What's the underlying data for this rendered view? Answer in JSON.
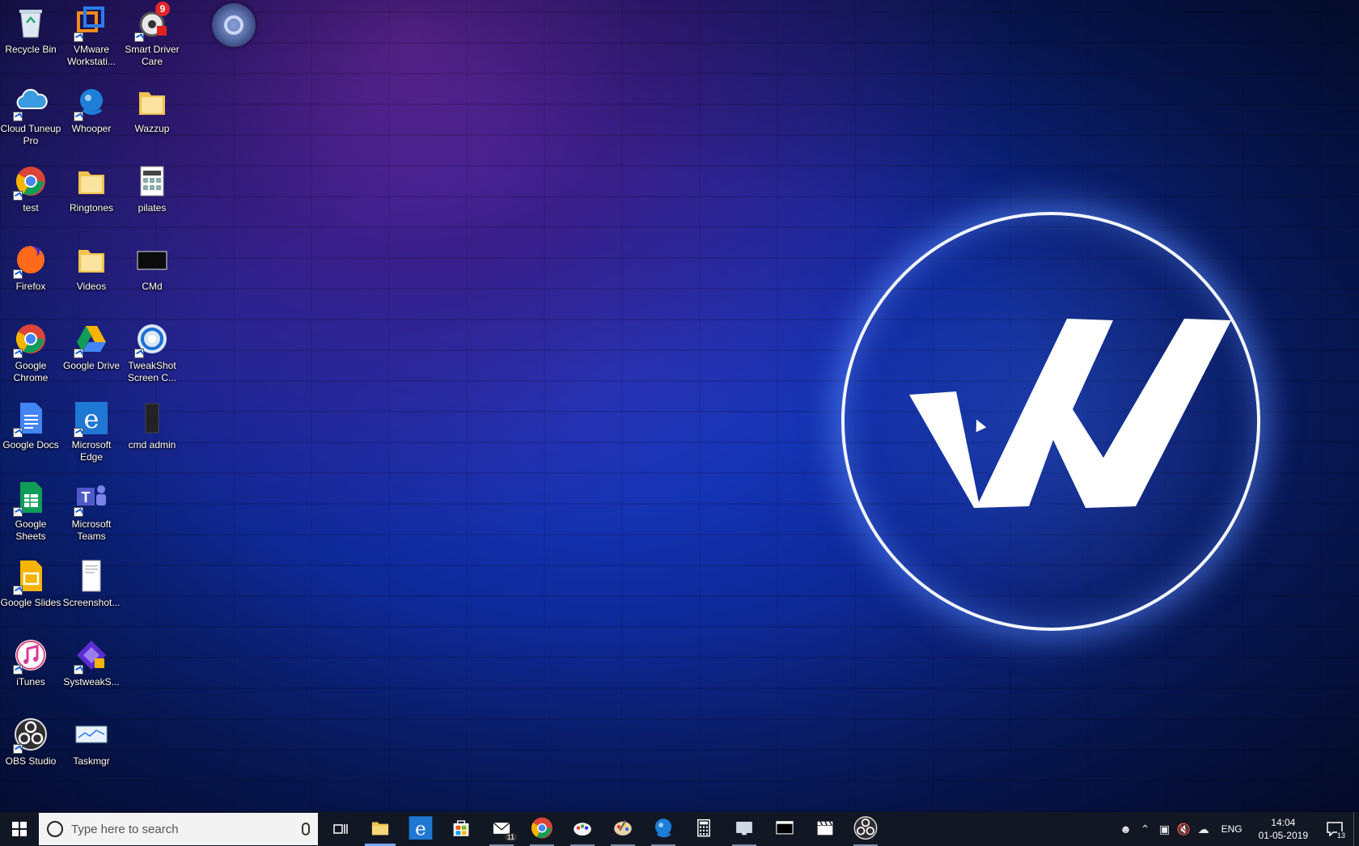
{
  "desktop_icons": [
    {
      "label": "Recycle Bin",
      "icon": "recycle-bin-icon"
    },
    {
      "label": "VMware Workstati...",
      "icon": "vmware-icon"
    },
    {
      "label": "Smart Driver Care",
      "icon": "smart-driver-care-icon",
      "badge": "9"
    },
    {
      "label": "Cloud Tuneup Pro",
      "icon": "cloud-tuneup-icon"
    },
    {
      "label": "Whooper",
      "icon": "whooper-icon"
    },
    {
      "label": "Wazzup",
      "icon": "folder-icon"
    },
    {
      "label": "test",
      "icon": "chrome-icon"
    },
    {
      "label": "Ringtones",
      "icon": "folder-icon"
    },
    {
      "label": "pilates",
      "icon": "image-file-icon"
    },
    {
      "label": "Firefox",
      "icon": "firefox-icon"
    },
    {
      "label": "Videos",
      "icon": "folder-icon"
    },
    {
      "label": "CMd",
      "icon": "cmd-icon"
    },
    {
      "label": "Google Chrome",
      "icon": "chrome-icon"
    },
    {
      "label": "Google Drive",
      "icon": "google-drive-icon"
    },
    {
      "label": "TweakShot Screen C...",
      "icon": "tweakshot-icon"
    },
    {
      "label": "Google Docs",
      "icon": "google-docs-icon"
    },
    {
      "label": "Microsoft Edge",
      "icon": "edge-icon"
    },
    {
      "label": "cmd admin",
      "icon": "cmd-admin-icon"
    },
    {
      "label": "Google Sheets",
      "icon": "google-sheets-icon"
    },
    {
      "label": "Microsoft Teams",
      "icon": "teams-icon"
    },
    {
      "label": "Google Slides",
      "icon": "google-slides-icon"
    },
    {
      "label": "Screenshot...",
      "icon": "document-icon"
    },
    {
      "label": "iTunes",
      "icon": "itunes-icon"
    },
    {
      "label": "SystweakS...",
      "icon": "systweak-icon"
    },
    {
      "label": "OBS Studio",
      "icon": "obs-icon"
    },
    {
      "label": "Taskmgr",
      "icon": "taskmgr-icon"
    }
  ],
  "taskbar": {
    "search_placeholder": "Type here to search",
    "apps": [
      {
        "name": "file-explorer-icon",
        "state": "active"
      },
      {
        "name": "edge-icon",
        "state": "none"
      },
      {
        "name": "store-icon",
        "state": "none"
      },
      {
        "name": "mail-icon",
        "state": "running",
        "badge": "11"
      },
      {
        "name": "chrome-icon",
        "state": "running"
      },
      {
        "name": "paint-app-icon",
        "state": "running"
      },
      {
        "name": "paint-palette-icon",
        "state": "running"
      },
      {
        "name": "whooper-icon",
        "state": "running"
      },
      {
        "name": "calculator-icon",
        "state": "none"
      },
      {
        "name": "monitor-app-icon",
        "state": "running"
      },
      {
        "name": "terminal-icon",
        "state": "none"
      },
      {
        "name": "clapper-icon",
        "state": "none"
      },
      {
        "name": "obs-icon",
        "state": "running"
      }
    ],
    "tray": {
      "language": "ENG",
      "time": "14:04",
      "date": "01-05-2019",
      "notification_count": "13"
    }
  },
  "colors": {
    "taskbar_bg": "#111723",
    "accent": "#76a7f0",
    "badge_red": "#e3262b"
  }
}
